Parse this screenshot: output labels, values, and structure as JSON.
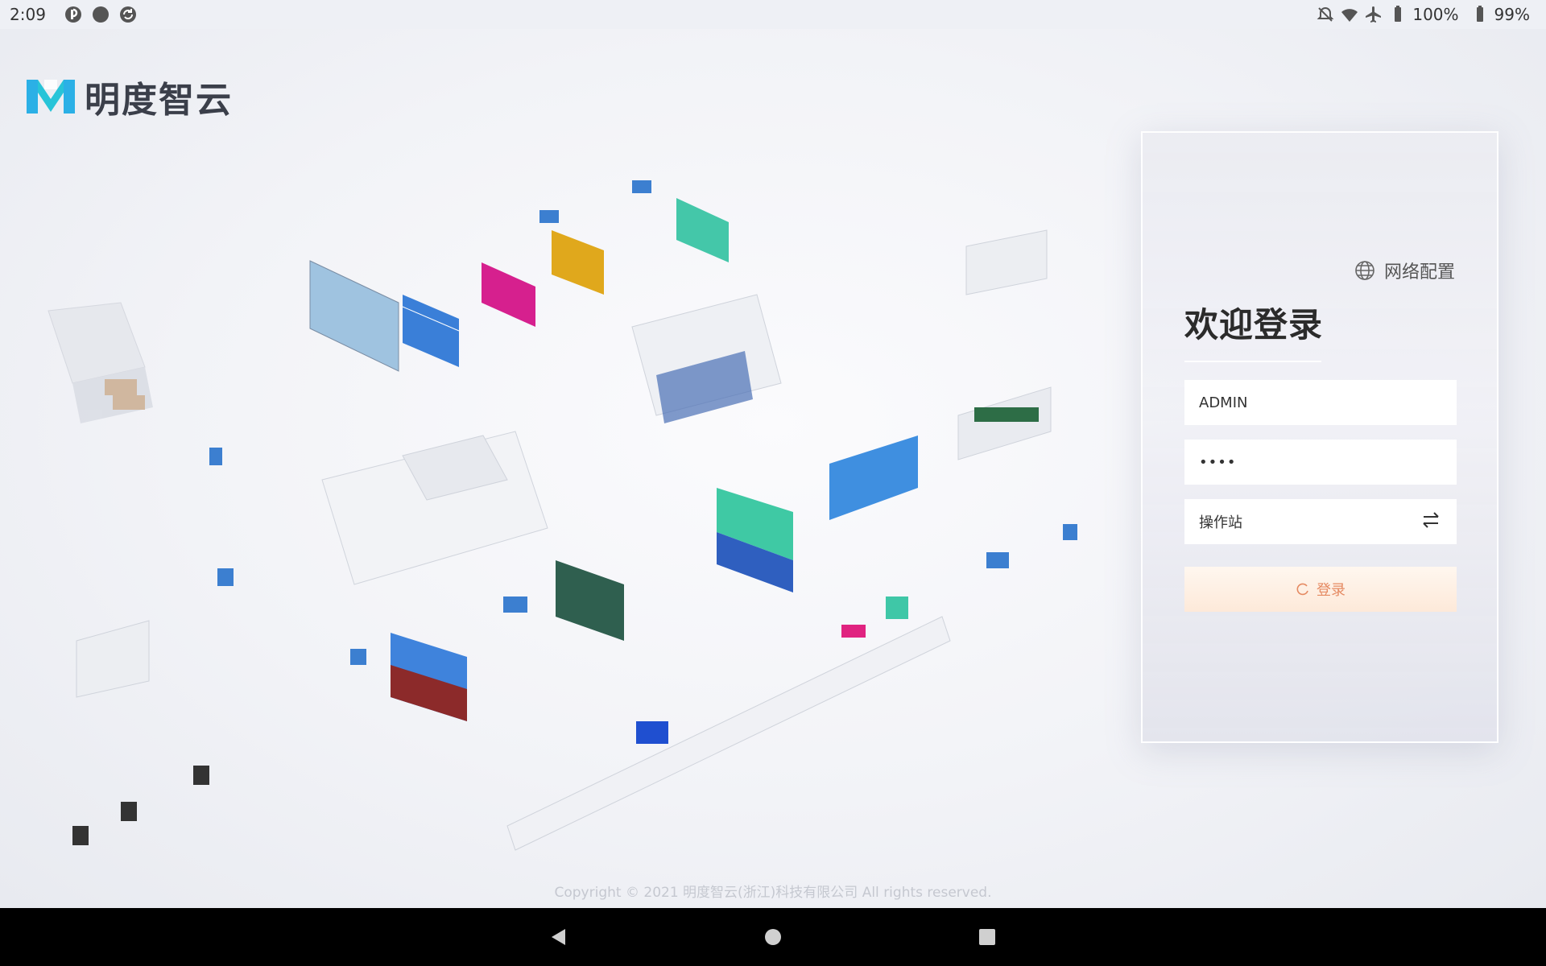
{
  "status_bar": {
    "time": "2:09",
    "battery_main": "100%",
    "battery_secondary": "99%",
    "icons": [
      "app-icon-1",
      "app-icon-2",
      "sync-icon",
      "mute-icon",
      "wifi-icon",
      "airplane-icon",
      "battery-icon"
    ]
  },
  "brand": {
    "name": "明度智云",
    "logo_color": "#2bb0e6"
  },
  "login": {
    "network_config_label": "网络配置",
    "welcome_title": "欢迎登录",
    "username_value": "ADMIN",
    "password_value": "••••",
    "station_label": "操作站",
    "login_button_label": "登录",
    "login_button_color": "#e58a62"
  },
  "footer": {
    "copyright": "Copyright © 2021 明度智云(浙江)科技有限公司 All rights reserved."
  },
  "nav_bar": {
    "buttons": [
      "back-icon",
      "home-icon",
      "recents-icon"
    ]
  }
}
